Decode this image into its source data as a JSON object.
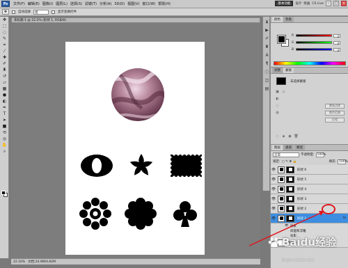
{
  "menubar": {
    "logo": "Ps",
    "items": [
      "文件(F)",
      "编辑(E)",
      "图像(I)",
      "图层(L)",
      "选择(S)",
      "滤镜(T)",
      "分析(A)",
      "3D(D)",
      "视图(V)",
      "窗口(W)",
      "帮助(H)"
    ],
    "zoom": "22.2",
    "workspace_button": "基本功能",
    "workspace_links": [
      "设计",
      "绘画"
    ],
    "cs_live": "CS Live",
    "window_controls": [
      "–",
      "□",
      "×"
    ]
  },
  "options_bar": {
    "tool_icon": "move-icon",
    "auto_select_label": "自动选择",
    "auto_select_value": "组",
    "show_transform_label": "显示变换控件"
  },
  "document": {
    "tab_title": "未标题-1 @ 22.2% (形状 1, RGB/8)",
    "status_zoom": "22.16%",
    "status_doc": "文档:24.9M/4.82M"
  },
  "color_panel": {
    "tabs": [
      "颜色",
      "色板"
    ],
    "channels": [
      {
        "name": "R",
        "value": "0",
        "gradient": "#ff0000"
      },
      {
        "name": "G",
        "value": "0",
        "gradient": "#00ff00"
      },
      {
        "name": "B",
        "value": "0",
        "gradient": "#0000ff"
      }
    ]
  },
  "styles_panel": {
    "tabs": [
      "调整",
      "蒙版"
    ],
    "title": "未选择蒙版",
    "buttons": [
      "蒙版边缘",
      "颜色范围",
      "反相"
    ]
  },
  "layers_panel": {
    "tabs": [
      "图层",
      "通道",
      "路径"
    ],
    "blend_mode": "正常",
    "opacity_label": "不透明度:",
    "opacity_value": "100%",
    "lock_label": "锁定:",
    "fill_label": "填充:",
    "fill_value": "100%",
    "layers": [
      {
        "name": "形状 6",
        "selected": false
      },
      {
        "name": "形状 5",
        "selected": false
      },
      {
        "name": "形状 4",
        "selected": false
      },
      {
        "name": "形状 3",
        "selected": false
      },
      {
        "name": "形状 2",
        "selected": false
      },
      {
        "name": "形状 1",
        "selected": true,
        "fx": "fx"
      }
    ],
    "effects_label": "效果",
    "effect_item": "投影",
    "bg_layer": "图层 0",
    "sub_items": [
      "斜面和浮雕",
      "投影"
    ],
    "footer_icons": [
      "link-icon",
      "fx-icon",
      "mask-icon",
      "adjust-icon",
      "folder-icon",
      "new-layer-icon",
      "trash-icon"
    ]
  },
  "watermark": {
    "brand": "Baidu经验",
    "url": "jingyan.baidu.com"
  },
  "colors": {
    "selected_layer": "#3d8ee0",
    "annotation": "#e0151b"
  }
}
